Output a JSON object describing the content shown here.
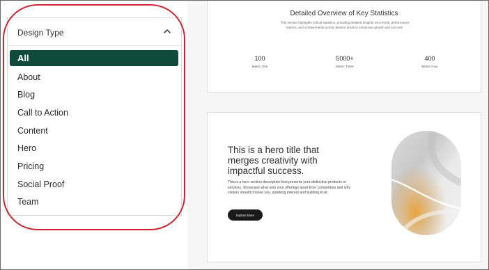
{
  "sidebar": {
    "dropdown": {
      "label": "Design Type",
      "expanded": true,
      "items": [
        {
          "label": "All",
          "active": true
        },
        {
          "label": "About"
        },
        {
          "label": "Blog"
        },
        {
          "label": "Call to Action"
        },
        {
          "label": "Content"
        },
        {
          "label": "Hero"
        },
        {
          "label": "Pricing"
        },
        {
          "label": "Social Proof"
        },
        {
          "label": "Team"
        }
      ]
    }
  },
  "stats_card": {
    "title": "Detailed Overview of Key Statistics",
    "description": "This section highlights critical statistics, providing detailed insights into trends, performance metrics, and achievements across diverse areas to showcase growth and success.",
    "metrics": [
      {
        "value": "100",
        "label": "Metric One"
      },
      {
        "value": "5000+",
        "label": "Metric Three"
      },
      {
        "value": "400",
        "label": "Metric Four"
      }
    ]
  },
  "hero_card": {
    "title": "This is a hero title that merges creativity with impactful success.",
    "description": "This is a hero section description that presents your distinctive products or services. Showcase what sets your offerings apart from competitors and why visitors should choose you, sparking interest and building trust.",
    "button_label": "Explore More"
  },
  "colors": {
    "active_item_bg": "#0f4a3a",
    "highlight_ring": "#cc2430",
    "button_bg": "#1a1a1a"
  },
  "icons": {
    "dropdown_toggle": "chevron-up-icon"
  }
}
